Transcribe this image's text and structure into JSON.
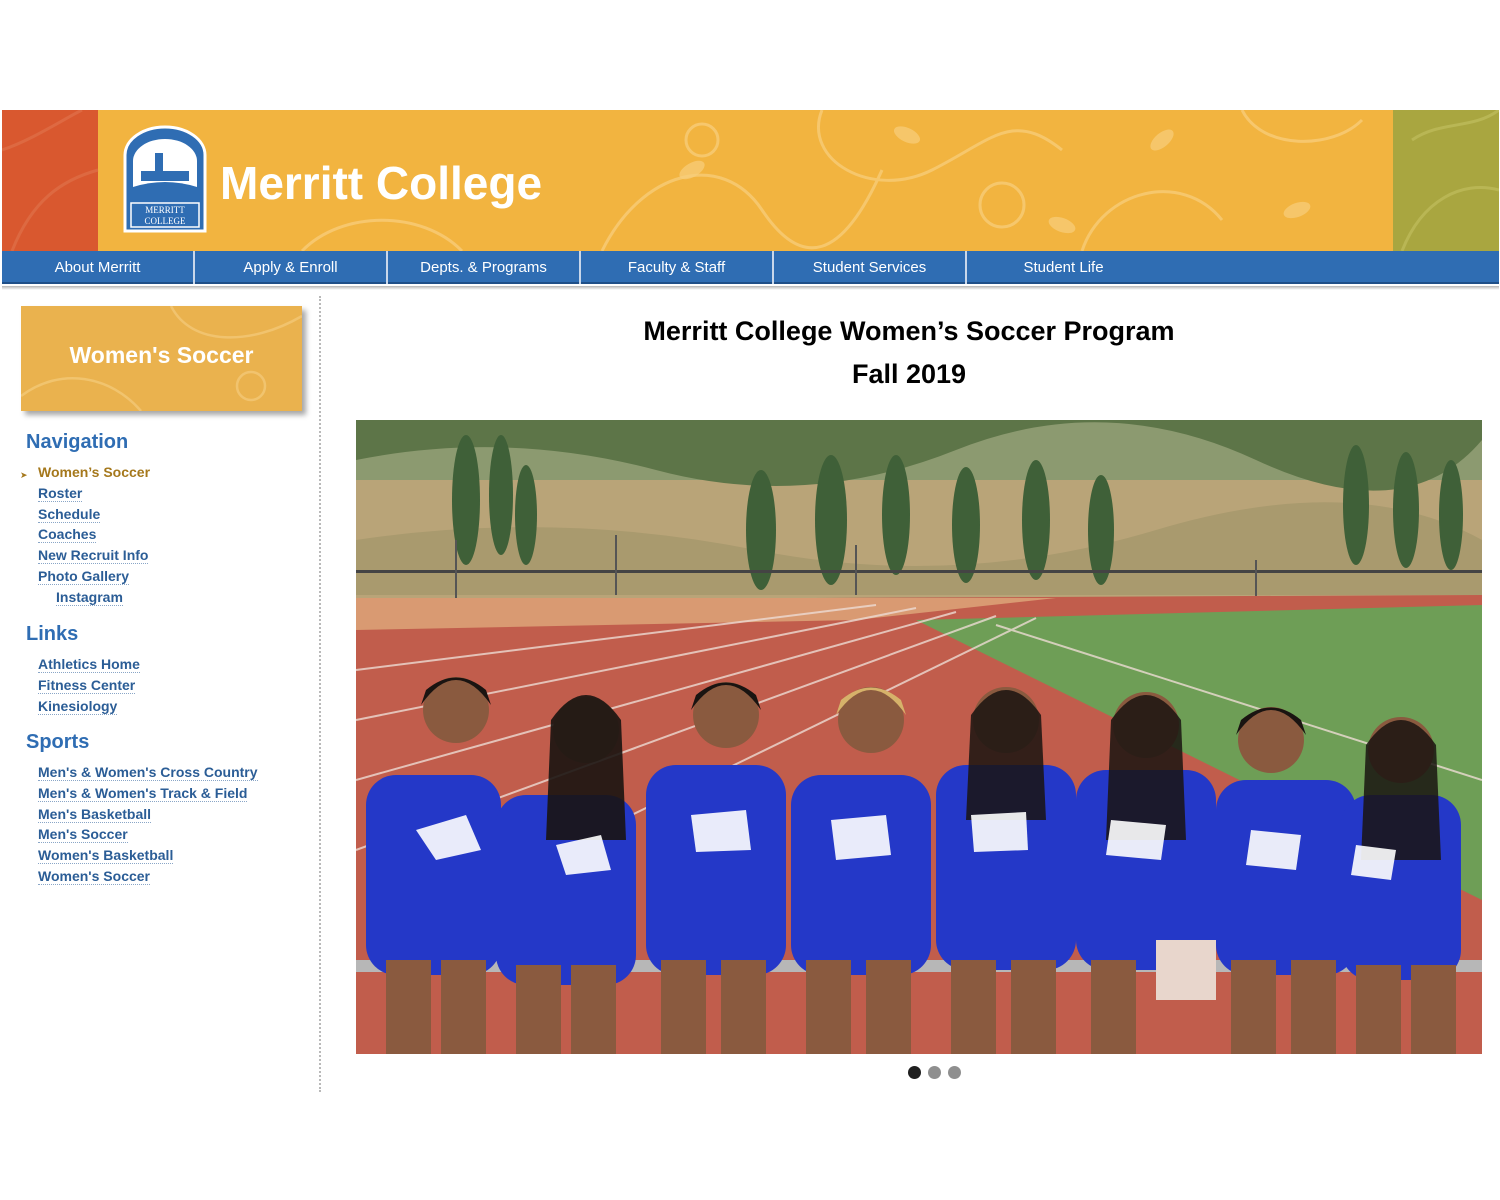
{
  "header": {
    "site_title": "Merritt College",
    "logo_text_line1": "MERRITT",
    "logo_text_line2": "COLLEGE",
    "colors": {
      "left_block": "#d9582f",
      "center": "#f2b440",
      "right_block": "#a9a640"
    }
  },
  "topnav": {
    "items": [
      {
        "label": "About Merritt"
      },
      {
        "label": "Apply & Enroll"
      },
      {
        "label": "Depts. & Programs"
      },
      {
        "label": "Faculty & Staff"
      },
      {
        "label": "Student Services"
      },
      {
        "label": "Student Life"
      }
    ],
    "color": "#2f6db3"
  },
  "sidebar": {
    "badge_label": "Women's Soccer",
    "navigation": {
      "heading": "Navigation",
      "items": [
        {
          "label": "Women’s Soccer"
        },
        {
          "label": "Roster"
        },
        {
          "label": "Schedule"
        },
        {
          "label": "Coaches"
        },
        {
          "label": "New Recruit Info"
        },
        {
          "label": "Photo Gallery"
        },
        {
          "label": "Instagram"
        }
      ]
    },
    "links": {
      "heading": "Links",
      "items": [
        {
          "label": "Athletics Home"
        },
        {
          "label": "Fitness Center"
        },
        {
          "label": "Kinesiology"
        }
      ]
    },
    "sports": {
      "heading": "Sports",
      "items": [
        {
          "label": "Men's & Women's Cross Country"
        },
        {
          "label": "Men's & Women's Track & Field"
        },
        {
          "label": "Men's Basketball"
        },
        {
          "label": "Men's Soccer"
        },
        {
          "label": "Women's Basketball"
        },
        {
          "label": "Women's Soccer"
        }
      ]
    }
  },
  "main": {
    "title_line1": "Merritt College Women’s Soccer Program",
    "title_line2": "Fall 2019",
    "carousel": {
      "slide_count": 3,
      "active_slide": 1
    }
  }
}
